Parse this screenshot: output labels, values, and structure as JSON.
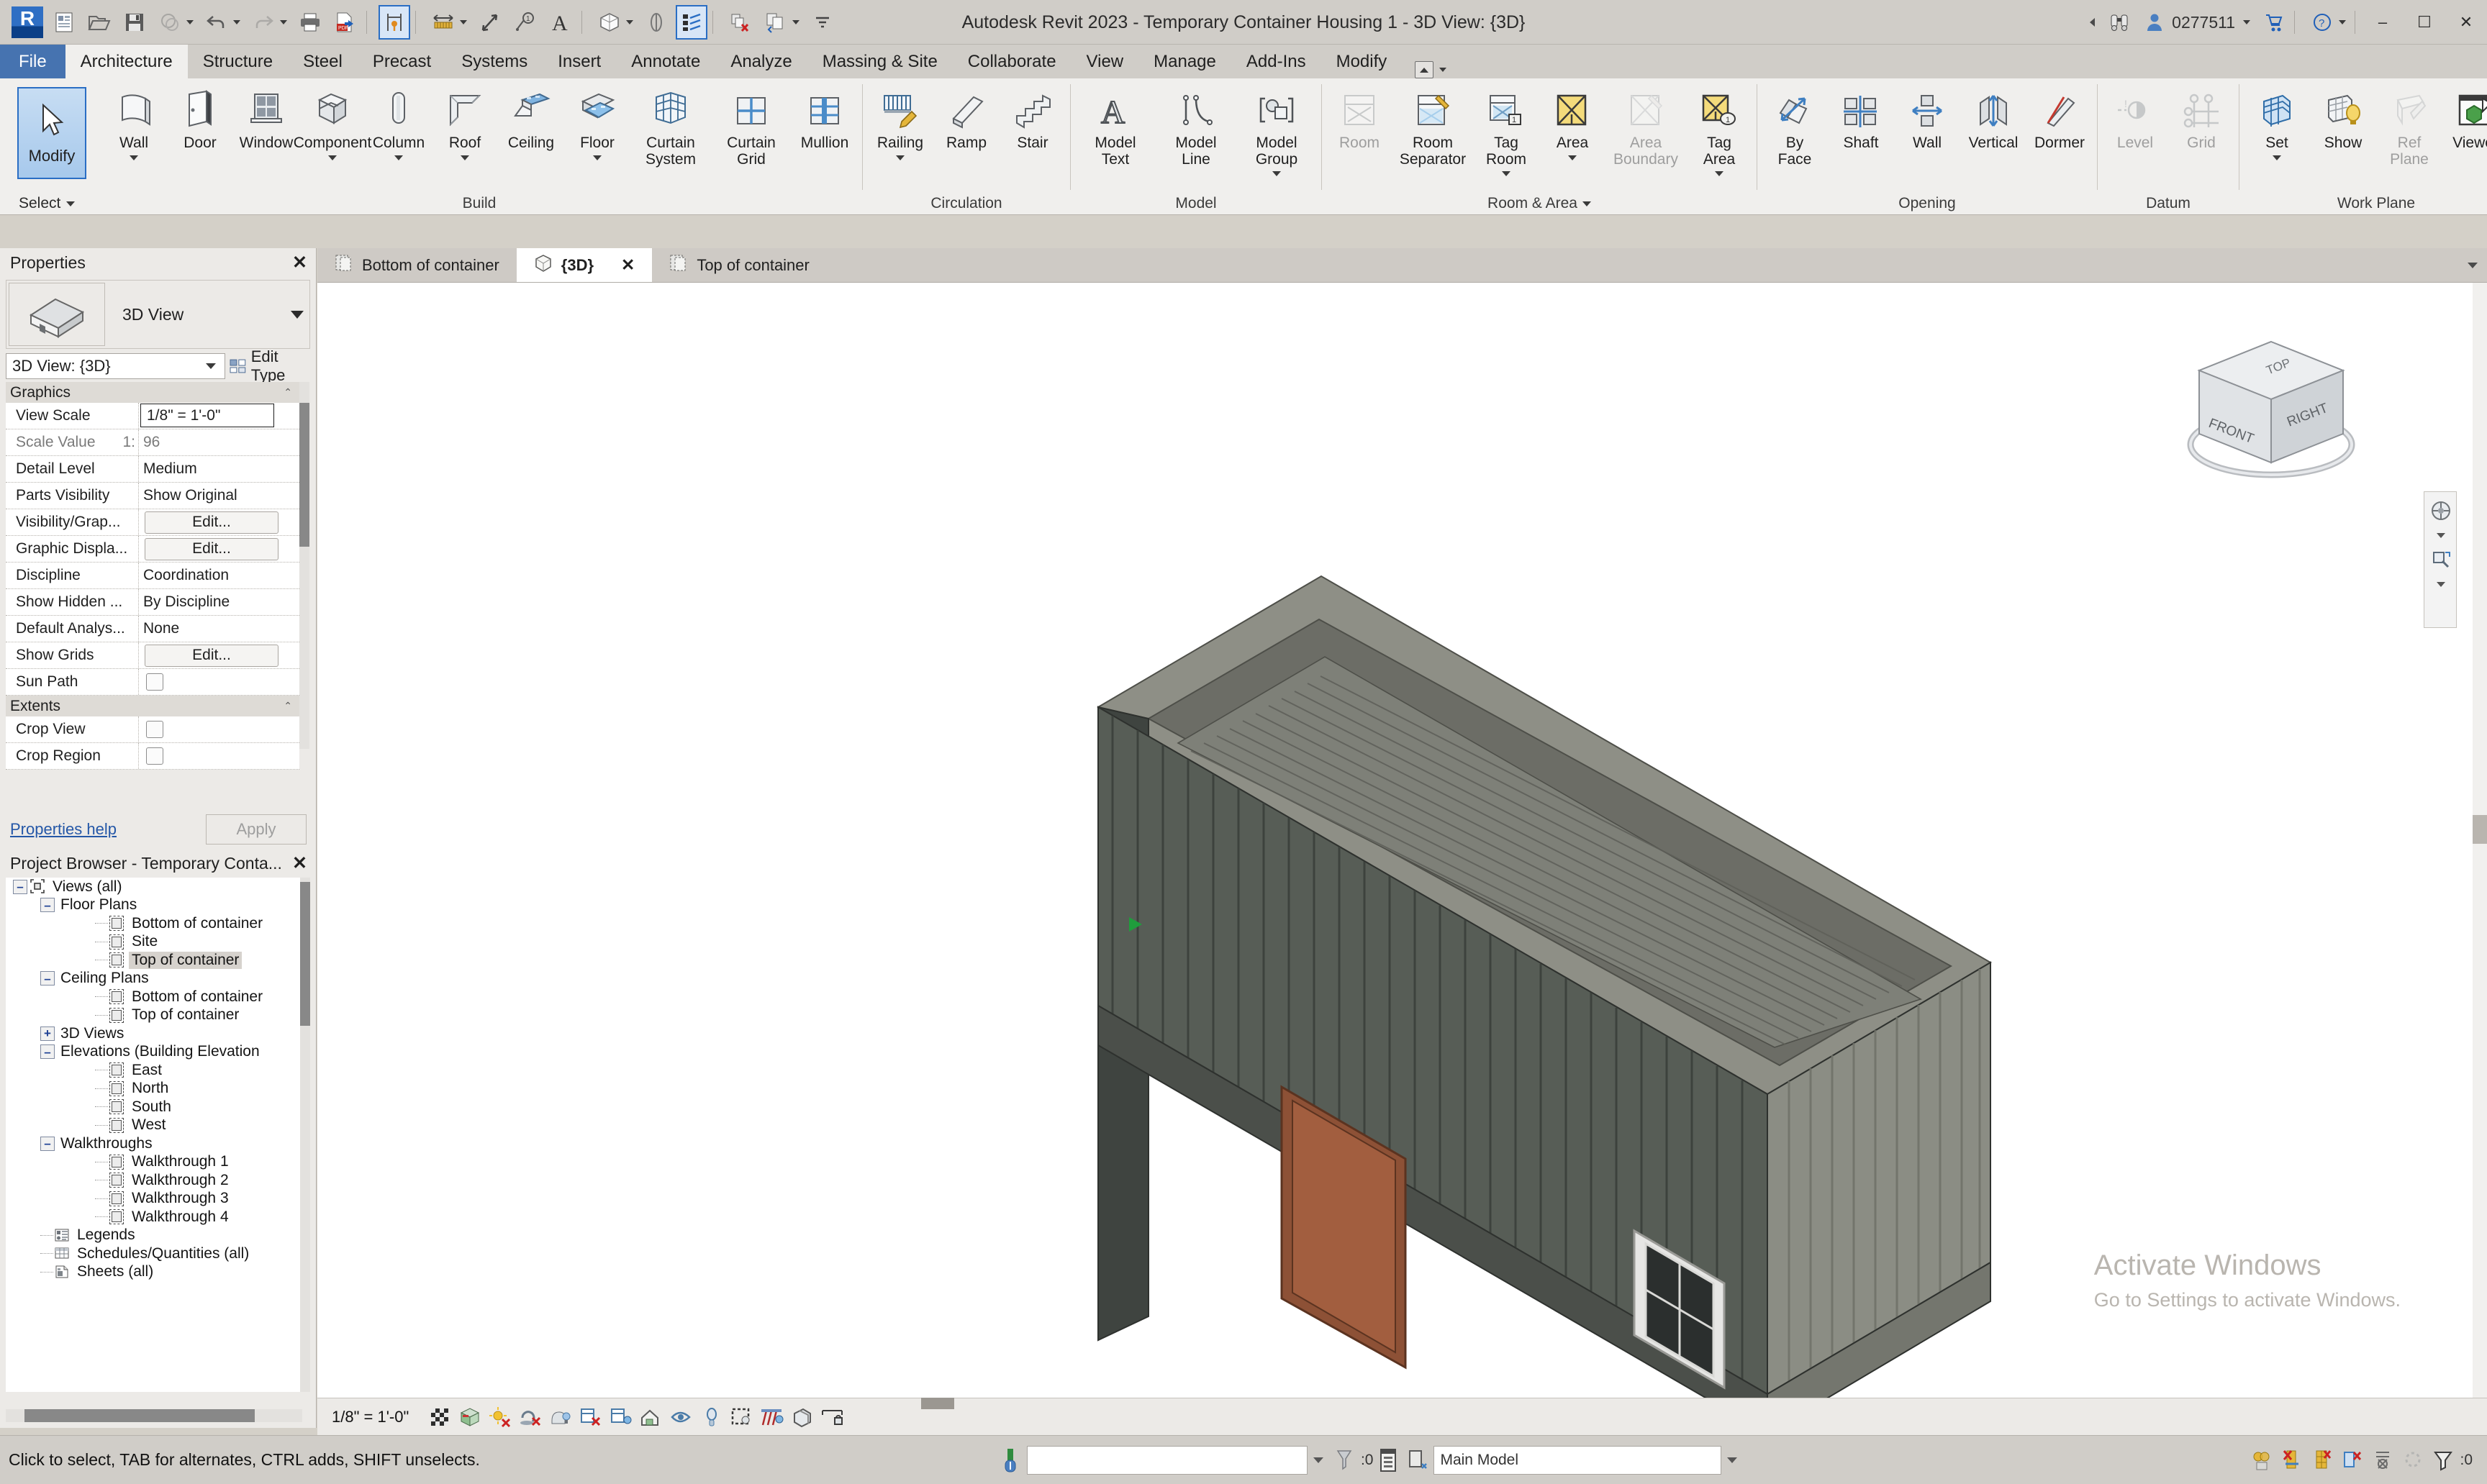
{
  "titlebar": {
    "app_title": "Autodesk Revit 2023 - Temporary Container Housing 1 - 3D View: {3D}",
    "user": "0277511",
    "minimize": "–",
    "maximize": "☐",
    "close": "✕",
    "qat_items": [
      {
        "name": "revit-logo",
        "label": "R"
      },
      {
        "name": "new-project-icon",
        "label": "New"
      },
      {
        "name": "open-project-icon",
        "label": "Open"
      },
      {
        "name": "save-icon",
        "label": "Save"
      },
      {
        "name": "save-as-icon",
        "label": "Save As"
      },
      {
        "name": "undo-icon",
        "label": "Undo"
      },
      {
        "name": "redo-icon",
        "label": "Redo"
      },
      {
        "name": "print-icon",
        "label": "Print"
      },
      {
        "name": "export-pdf-icon",
        "label": "Export PDF"
      },
      {
        "name": "measure-pin-icon",
        "label": "Measure"
      },
      {
        "name": "aligned-dimension-icon",
        "label": "Aligned Dimension"
      },
      {
        "name": "tag-icon",
        "label": "Tag"
      },
      {
        "name": "keynote-icon",
        "label": "Keynote"
      },
      {
        "name": "text-icon",
        "label": "Text"
      },
      {
        "name": "default-3d-view-icon",
        "label": "Default 3D View"
      },
      {
        "name": "section-icon",
        "label": "Section"
      },
      {
        "name": "thin-lines-icon",
        "label": "Thin Lines"
      },
      {
        "name": "close-hidden-windows-icon",
        "label": "Close Hidden Windows"
      },
      {
        "name": "switch-windows-icon",
        "label": "Switch Windows"
      },
      {
        "name": "customize-qat-icon",
        "label": "Customize Quick Access Toolbar"
      }
    ]
  },
  "ribbon": {
    "tabs": [
      {
        "label": "File",
        "active": false,
        "kind": "file"
      },
      {
        "label": "Architecture",
        "active": true
      },
      {
        "label": "Structure",
        "active": false
      },
      {
        "label": "Steel",
        "active": false
      },
      {
        "label": "Precast",
        "active": false
      },
      {
        "label": "Systems",
        "active": false
      },
      {
        "label": "Insert",
        "active": false
      },
      {
        "label": "Annotate",
        "active": false
      },
      {
        "label": "Analyze",
        "active": false
      },
      {
        "label": "Massing & Site",
        "active": false
      },
      {
        "label": "Collaborate",
        "active": false
      },
      {
        "label": "View",
        "active": false
      },
      {
        "label": "Manage",
        "active": false
      },
      {
        "label": "Add-Ins",
        "active": false
      },
      {
        "label": "Modify",
        "active": false
      }
    ],
    "select_panel": {
      "modify_label": "Modify",
      "panel_title": "Select"
    },
    "panels": [
      {
        "title": "Build",
        "has_dropdown": false,
        "buttons": [
          {
            "label": "Wall",
            "icon": "wall-icon",
            "dropdown": true,
            "disabled": false
          },
          {
            "label": "Door",
            "icon": "door-icon",
            "dropdown": false,
            "disabled": false
          },
          {
            "label": "Window",
            "icon": "window-icon",
            "dropdown": false,
            "disabled": false
          },
          {
            "label": "Component",
            "icon": "component-icon",
            "dropdown": true,
            "disabled": false
          },
          {
            "label": "Column",
            "icon": "column-icon",
            "dropdown": true,
            "disabled": false
          },
          {
            "label": "Roof",
            "icon": "roof-icon",
            "dropdown": true,
            "disabled": false
          },
          {
            "label": "Ceiling",
            "icon": "ceiling-icon",
            "dropdown": false,
            "disabled": false
          },
          {
            "label": "Floor",
            "icon": "floor-icon",
            "dropdown": true,
            "disabled": false
          },
          {
            "label": "Curtain\nSystem",
            "icon": "curtain-system-icon",
            "dropdown": false,
            "disabled": false
          },
          {
            "label": "Curtain\nGrid",
            "icon": "curtain-grid-icon",
            "dropdown": false,
            "disabled": false
          },
          {
            "label": "Mullion",
            "icon": "mullion-icon",
            "dropdown": false,
            "disabled": false
          }
        ]
      },
      {
        "title": "Circulation",
        "has_dropdown": false,
        "buttons": [
          {
            "label": "Railing",
            "icon": "railing-icon",
            "dropdown": true,
            "disabled": false
          },
          {
            "label": "Ramp",
            "icon": "ramp-icon",
            "dropdown": false,
            "disabled": false
          },
          {
            "label": "Stair",
            "icon": "stair-icon",
            "dropdown": false,
            "disabled": false
          }
        ]
      },
      {
        "title": "Model",
        "has_dropdown": false,
        "buttons": [
          {
            "label": "Model\nText",
            "icon": "model-text-icon",
            "dropdown": false,
            "disabled": false
          },
          {
            "label": "Model\nLine",
            "icon": "model-line-icon",
            "dropdown": false,
            "disabled": false
          },
          {
            "label": "Model\nGroup",
            "icon": "model-group-icon",
            "dropdown": true,
            "disabled": false
          }
        ]
      },
      {
        "title": "Room & Area",
        "has_dropdown": true,
        "buttons": [
          {
            "label": "Room",
            "icon": "room-icon",
            "dropdown": false,
            "disabled": true
          },
          {
            "label": "Room\nSeparator",
            "icon": "room-separator-icon",
            "dropdown": false,
            "disabled": false
          },
          {
            "label": "Tag\nRoom",
            "icon": "tag-room-icon",
            "dropdown": true,
            "disabled": false
          },
          {
            "label": "Area",
            "icon": "area-icon",
            "dropdown": true,
            "disabled": false
          },
          {
            "label": "Area\nBoundary",
            "icon": "area-boundary-icon",
            "dropdown": false,
            "disabled": true
          },
          {
            "label": "Tag\nArea",
            "icon": "tag-area-icon",
            "dropdown": true,
            "disabled": false
          }
        ]
      },
      {
        "title": "Opening",
        "has_dropdown": false,
        "buttons": [
          {
            "label": "By\nFace",
            "icon": "opening-by-face-icon",
            "dropdown": false,
            "disabled": false
          },
          {
            "label": "Shaft",
            "icon": "shaft-opening-icon",
            "dropdown": false,
            "disabled": false
          },
          {
            "label": "Wall",
            "icon": "wall-opening-icon",
            "dropdown": false,
            "disabled": false
          },
          {
            "label": "Vertical",
            "icon": "vertical-opening-icon",
            "dropdown": false,
            "disabled": false
          },
          {
            "label": "Dormer",
            "icon": "dormer-opening-icon",
            "dropdown": false,
            "disabled": false
          }
        ]
      },
      {
        "title": "Datum",
        "has_dropdown": false,
        "buttons": [
          {
            "label": "Level",
            "icon": "level-icon",
            "dropdown": false,
            "disabled": true
          },
          {
            "label": "Grid",
            "icon": "grid-icon",
            "dropdown": false,
            "disabled": true
          }
        ]
      },
      {
        "title": "Work Plane",
        "has_dropdown": false,
        "buttons": [
          {
            "label": "Set",
            "icon": "set-work-plane-icon",
            "dropdown": true,
            "disabled": false
          },
          {
            "label": "Show",
            "icon": "show-work-plane-icon",
            "dropdown": false,
            "disabled": false
          },
          {
            "label": "Ref\nPlane",
            "icon": "ref-plane-icon",
            "dropdown": false,
            "disabled": true
          },
          {
            "label": "Viewer",
            "icon": "work-plane-viewer-icon",
            "dropdown": false,
            "disabled": false
          }
        ]
      }
    ]
  },
  "properties": {
    "title": "Properties",
    "close": "✕",
    "type_name": "3D View",
    "selector_value": "3D View: {3D}",
    "edit_type": "Edit Type",
    "help_link": "Properties help",
    "apply": "Apply",
    "groups": [
      {
        "name": "Graphics",
        "rows": [
          {
            "name": "View Scale",
            "value": "1/8\" = 1'-0\"",
            "kind": "boxed"
          },
          {
            "name": "Scale Value",
            "value": "96",
            "prefix": "1:",
            "kind": "readonly"
          },
          {
            "name": "Detail Level",
            "value": "Medium",
            "kind": "text"
          },
          {
            "name": "Parts Visibility",
            "value": "Show Original",
            "kind": "text"
          },
          {
            "name": "Visibility/Grap...",
            "value": "Edit...",
            "kind": "button"
          },
          {
            "name": "Graphic Displa...",
            "value": "Edit...",
            "kind": "button"
          },
          {
            "name": "Discipline",
            "value": "Coordination",
            "kind": "text"
          },
          {
            "name": "Show Hidden ...",
            "value": "By Discipline",
            "kind": "text"
          },
          {
            "name": "Default Analys...",
            "value": "None",
            "kind": "text"
          },
          {
            "name": "Show Grids",
            "value": "Edit...",
            "kind": "button"
          },
          {
            "name": "Sun Path",
            "value": "",
            "kind": "checkbox"
          }
        ]
      },
      {
        "name": "Extents",
        "rows": [
          {
            "name": "Crop View",
            "value": "",
            "kind": "checkbox"
          },
          {
            "name": "Crop Region",
            "value": "",
            "kind": "checkbox"
          }
        ]
      }
    ]
  },
  "browser": {
    "title": "Project Browser - Temporary Conta...",
    "close": "✕",
    "nodes": [
      {
        "label": "Views (all)",
        "depth": 0,
        "toggle": "minus",
        "icon": "views-all-icon",
        "selected": false
      },
      {
        "label": "Floor Plans",
        "depth": 1,
        "toggle": "minus",
        "icon": "none",
        "selected": false
      },
      {
        "label": "Bottom of container",
        "depth": 3,
        "toggle": "none",
        "icon": "view-icon",
        "selected": false
      },
      {
        "label": "Site",
        "depth": 3,
        "toggle": "none",
        "icon": "view-icon",
        "selected": false
      },
      {
        "label": "Top of container",
        "depth": 3,
        "toggle": "none",
        "icon": "view-icon",
        "selected": true
      },
      {
        "label": "Ceiling Plans",
        "depth": 1,
        "toggle": "minus",
        "icon": "none",
        "selected": false
      },
      {
        "label": "Bottom of container",
        "depth": 3,
        "toggle": "none",
        "icon": "view-icon",
        "selected": false
      },
      {
        "label": "Top of container",
        "depth": 3,
        "toggle": "none",
        "icon": "view-icon",
        "selected": false
      },
      {
        "label": "3D Views",
        "depth": 1,
        "toggle": "plus",
        "icon": "none",
        "selected": false
      },
      {
        "label": "Elevations (Building Elevation",
        "depth": 1,
        "toggle": "minus",
        "icon": "none",
        "selected": false
      },
      {
        "label": "East",
        "depth": 3,
        "toggle": "none",
        "icon": "view-icon",
        "selected": false
      },
      {
        "label": "North",
        "depth": 3,
        "toggle": "none",
        "icon": "view-icon",
        "selected": false
      },
      {
        "label": "South",
        "depth": 3,
        "toggle": "none",
        "icon": "view-icon",
        "selected": false
      },
      {
        "label": "West",
        "depth": 3,
        "toggle": "none",
        "icon": "view-icon",
        "selected": false
      },
      {
        "label": "Walkthroughs",
        "depth": 1,
        "toggle": "minus",
        "icon": "none",
        "selected": false
      },
      {
        "label": "Walkthrough 1",
        "depth": 3,
        "toggle": "none",
        "icon": "view-icon",
        "selected": false
      },
      {
        "label": "Walkthrough 2",
        "depth": 3,
        "toggle": "none",
        "icon": "view-icon",
        "selected": false
      },
      {
        "label": "Walkthrough 3",
        "depth": 3,
        "toggle": "none",
        "icon": "view-icon",
        "selected": false
      },
      {
        "label": "Walkthrough 4",
        "depth": 3,
        "toggle": "none",
        "icon": "view-icon",
        "selected": false
      },
      {
        "label": "Legends",
        "depth": 1,
        "toggle": "none",
        "icon": "legends-icon",
        "selected": false
      },
      {
        "label": "Schedules/Quantities (all)",
        "depth": 1,
        "toggle": "none",
        "icon": "schedules-icon",
        "selected": false
      },
      {
        "label": "Sheets (all)",
        "depth": 1,
        "toggle": "none",
        "icon": "sheets-icon",
        "selected": false
      }
    ]
  },
  "view_tabs": [
    {
      "label": "Bottom of container",
      "active": false,
      "icon": "view-tab-icon",
      "closable": false
    },
    {
      "label": "{3D}",
      "active": true,
      "icon": "view-3d-icon",
      "closable": true
    },
    {
      "label": "Top of container",
      "active": false,
      "icon": "view-tab-icon",
      "closable": false
    }
  ],
  "view_tab_close": "✕",
  "canvas": {
    "viewcube": {
      "top": "TOP",
      "front": "FRONT",
      "right": "RIGHT"
    },
    "watermark_line1": "Activate Windows",
    "watermark_line2": "Go to Settings to activate Windows."
  },
  "view_control_bar": {
    "scale": "1/8\" = 1'-0\"",
    "icons": [
      {
        "name": "detail-level-icon",
        "label": "Detail Level"
      },
      {
        "name": "visual-style-icon",
        "label": "Visual Style"
      },
      {
        "name": "sun-path-off-icon",
        "label": "Sun Path Off"
      },
      {
        "name": "shadows-off-icon",
        "label": "Shadows Off"
      },
      {
        "name": "rendering-dialog-icon",
        "label": "Show Rendering Dialog"
      },
      {
        "name": "crop-view-off-icon",
        "label": "Crop View Off"
      },
      {
        "name": "show-crop-region-icon",
        "label": "Show Crop Region"
      },
      {
        "name": "lock-3d-view-icon",
        "label": "Lock 3D View"
      },
      {
        "name": "temporary-hide-isolate-icon",
        "label": "Temporary Hide/Isolate"
      },
      {
        "name": "reveal-hidden-elements-icon",
        "label": "Reveal Hidden Elements"
      },
      {
        "name": "temporary-view-properties-icon",
        "label": "Temporary View Properties"
      },
      {
        "name": "show-analytical-model-icon",
        "label": "Show Analytical Model"
      },
      {
        "name": "highlight-displacement-icon",
        "label": "Highlight Displacement Sets"
      },
      {
        "name": "measure-constraints-icon",
        "label": "Reveal Constraints"
      }
    ]
  },
  "status_bar": {
    "message": "Click to select, TAB for alternates, CTRL adds, SHIFT unselects.",
    "filter_value": "",
    "count": "0",
    "worksets_value": "Main Model",
    "filter_count": "0",
    "right_icons": [
      {
        "name": "design-options-icon",
        "label": "Design Options"
      },
      {
        "name": "exclude-options-icon",
        "label": "Exclude Options"
      },
      {
        "name": "active-design-option-icon",
        "label": "Active Design Option"
      },
      {
        "name": "editable-only-icon",
        "label": "Editable Only"
      },
      {
        "name": "select-links-icon",
        "label": "Select Links"
      },
      {
        "name": "select-underlay-icon",
        "label": "Select Underlay Elements"
      },
      {
        "name": "filter-icon",
        "label": "Filter"
      }
    ]
  }
}
